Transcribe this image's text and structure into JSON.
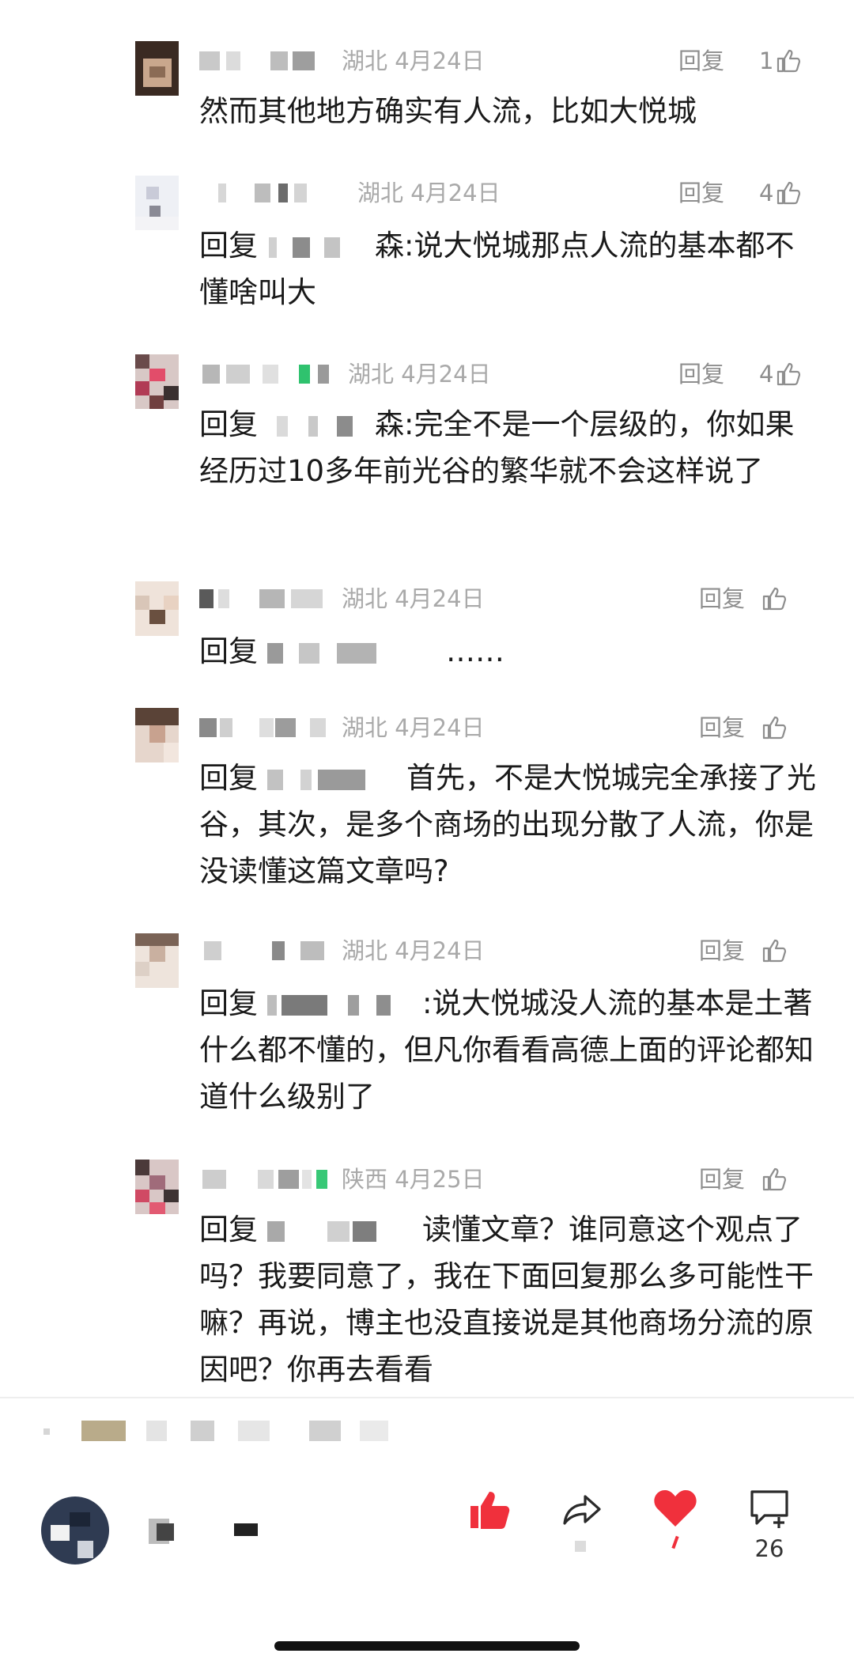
{
  "reply_label": "回复",
  "comments": [
    {
      "location_date": "湖北 4月24日",
      "likes": "1",
      "text_after": "然而其他地方确实有人流，比如大悦城",
      "prefix": "",
      "target_tail": ""
    },
    {
      "location_date": "湖北 4月24日",
      "likes": "4",
      "prefix": "回复",
      "target_tail": "森:",
      "text_after": "说大悦城那点人流的基本都不懂啥叫大"
    },
    {
      "location_date": "湖北 4月24日",
      "likes": "4",
      "prefix": "回复",
      "target_tail": "森:",
      "text_after": "完全不是一个层级的，你如果经历过10多年前光谷的繁华就不会这样说了"
    },
    {
      "location_date": "湖北 4月24日",
      "likes": "",
      "prefix": "回复",
      "target_tail": "",
      "text_after": "……"
    },
    {
      "location_date": "湖北 4月24日",
      "likes": "",
      "prefix": "回复",
      "target_tail": "",
      "text_after": "首先，不是大悦城完全承接了光谷，其次，是多个商场的出现分散了人流，你是没读懂这篇文章吗?"
    },
    {
      "location_date": "湖北 4月24日",
      "likes": "",
      "prefix": "回复",
      "target_tail": ":",
      "text_after": "说大悦城没人流的基本是土著什么都不懂的，但凡你看看高德上面的评论都知道什么级别了"
    },
    {
      "location_date": "陕西 4月25日",
      "likes": "",
      "prefix": "回复",
      "target_tail": "",
      "text_after": "读懂文章？谁同意这个观点了吗？我要同意了，我在下面回复那么多可能性干嘛？再说，博主也没直接说是其他商场分流的原因吧？你再去看看"
    }
  ],
  "action_bar": {
    "comment_count": "26",
    "icons": [
      "thumbs-up-icon",
      "share-icon",
      "heart-icon",
      "comment-add-icon"
    ],
    "accent_color": "#f0303c"
  }
}
